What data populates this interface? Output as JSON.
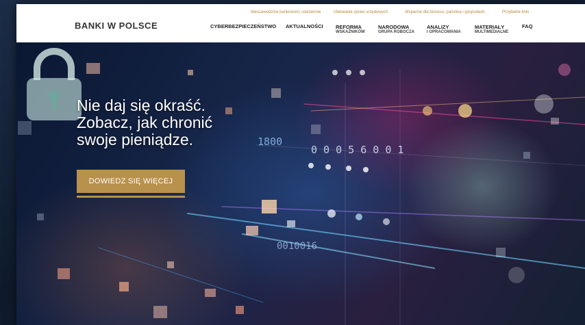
{
  "header": {
    "logo": "BANKI W POLSCE",
    "top_links": [
      "Nieszawodzina bankowość codziennie",
      "Ułatwianie spraw urzędowych",
      "Wsparcie dla biznesu, państwa i gospodarki",
      "Przydatne linki"
    ],
    "nav": [
      {
        "line1": "CYBERBEZPIECZEŃSTWO",
        "line2": ""
      },
      {
        "line1": "AKTUALNOŚCI",
        "line2": ""
      },
      {
        "line1": "REFORMA",
        "line2": "WSKAŹNIKÓW"
      },
      {
        "line1": "NARODOWA",
        "line2": "GRUPA ROBOCZA"
      },
      {
        "line1": "ANALIZY",
        "line2": "I OPRACOWANIA"
      },
      {
        "line1": "MATERIAŁY",
        "line2": "MULTIMEDIALNE"
      },
      {
        "line1": "FAQ",
        "line2": ""
      }
    ]
  },
  "hero": {
    "title_lines": [
      "Nie daj się okraść.",
      "Zobacz, jak chronić",
      "swoje pieniądze."
    ],
    "cta_label": "DOWIEDZ SIĘ WIĘCEJ",
    "binary_1": "1800",
    "binary_2": "0 0 0 5 6 0 0 1",
    "binary_3": "0010016",
    "lock_icon": "padlock-icon"
  },
  "colors": {
    "accent_gold": "#b8914d",
    "header_bg": "#ffffff",
    "nav_text": "#222222"
  }
}
